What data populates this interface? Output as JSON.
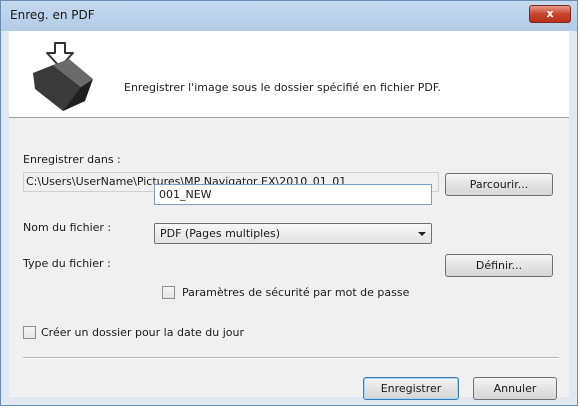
{
  "window": {
    "title": "Enreg. en PDF",
    "close_glyph": "x"
  },
  "banner": {
    "icon": "save-folder-icon",
    "text": "Enregistrer l'image sous le dossier spécifié en fichier PDF."
  },
  "save_location": {
    "label": "Enregistrer dans :",
    "path": "C:\\Users\\UserName\\Pictures\\MP Navigator EX\\2010_01_01",
    "browse_label": "Parcourir..."
  },
  "file_name": {
    "label": "Nom du fichier :",
    "value": "001_NEW"
  },
  "file_type": {
    "label": "Type du fichier :",
    "selected": "PDF (Pages multiples)",
    "settings_label": "Définir..."
  },
  "password_security": {
    "label": "Paramètres de sécurité par mot de passe",
    "checked": false
  },
  "date_folder": {
    "label": "Créer un dossier pour la date du jour",
    "checked": false
  },
  "actions": {
    "save_label": "Enregistrer",
    "cancel_label": "Annuler"
  }
}
